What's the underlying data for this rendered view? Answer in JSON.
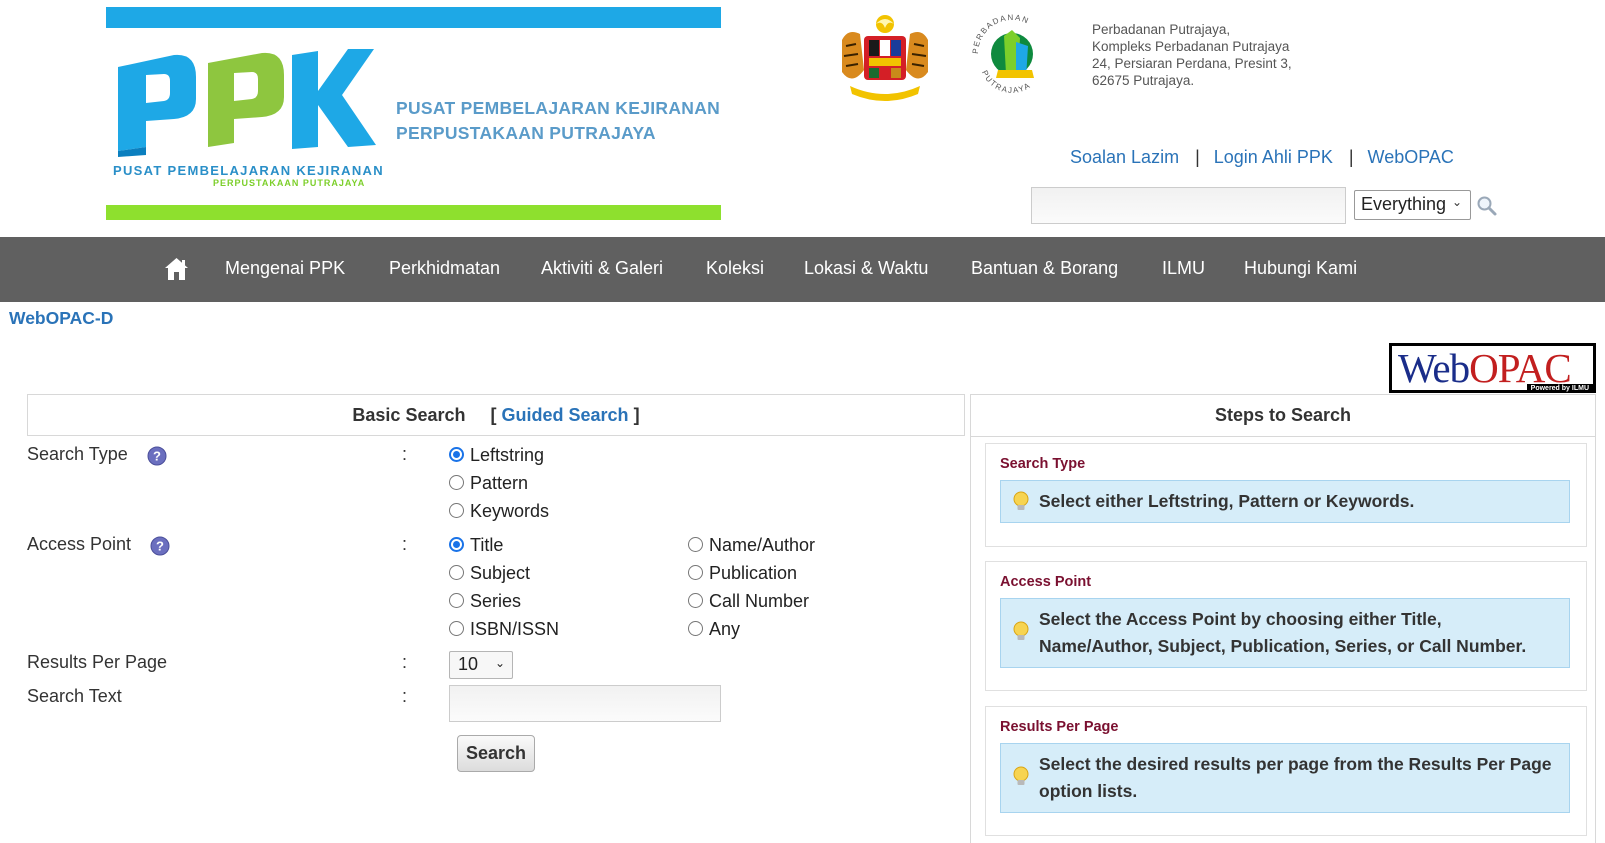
{
  "header": {
    "banner_title_line1": "PUSAT PEMBELAJARAN KEJIRANAN",
    "banner_title_line2": "PERPUSTAKAAN PUTRAJAYA",
    "logo_text": "PPK",
    "logo_sub1": "PUSAT PEMBELAJARAN KEJIRANAN",
    "logo_sub2": "PERPUSTAKAAN PUTRAJAYA",
    "address": [
      "Perbadanan Putrajaya,",
      "Kompleks Perbadanan Putrajaya",
      "24, Persiaran Perdana, Presint 3,",
      "62675 Putrajaya."
    ],
    "links": [
      "Soalan Lazim",
      "Login Ahli PPK",
      "WebOPAC"
    ],
    "separator": "|",
    "search": {
      "value": "",
      "scope": "Everything"
    }
  },
  "nav": {
    "items": [
      "Mengenai PPK",
      "Perkhidmatan",
      "Aktiviti & Galeri",
      "Koleksi",
      "Lokasi & Waktu",
      "Bantuan & Borang",
      "ILMU",
      "Hubungi Kami"
    ]
  },
  "page": {
    "title": "WebOPAC-D",
    "logo_text_a": "Web",
    "logo_text_b": "OPAC",
    "logo_powered": "Powered by ILMU"
  },
  "form": {
    "header_basic": "Basic Search",
    "bracket_open": "[",
    "guided_link": "Guided Search",
    "bracket_close": "]",
    "colon": ":",
    "search_type_label": "Search Type",
    "search_type_options": [
      "Leftstring",
      "Pattern",
      "Keywords"
    ],
    "search_type_selected": "Leftstring",
    "access_point_label": "Access Point",
    "access_point_options": [
      "Title",
      "Subject",
      "Series",
      "ISBN/ISSN",
      "Name/Author",
      "Publication",
      "Call Number",
      "Any"
    ],
    "access_point_selected": "Title",
    "results_per_page_label": "Results Per Page",
    "results_per_page_value": "10",
    "search_text_label": "Search Text",
    "search_text_value": "",
    "search_button": "Search"
  },
  "steps": {
    "title": "Steps to Search",
    "items": [
      {
        "title": "Search Type",
        "text": "Select either Leftstring, Pattern or Keywords."
      },
      {
        "title": "Access Point",
        "text": "Select the Access Point by choosing either Title, Name/Author, Subject, Publication, Series, or Call Number."
      },
      {
        "title": "Results Per Page",
        "text": "Select the desired results per page from the Results Per Page option lists."
      }
    ]
  },
  "colors": {
    "link_blue": "#2a73b8",
    "nav_bg": "#606060",
    "banner_top": "#1ea8e6",
    "banner_bottom": "#8ee02e",
    "step_title": "#7a1030",
    "step_box_bg": "#d6edf9"
  },
  "icons": [
    "home-icon",
    "help-icon",
    "search-icon",
    "lightbulb-icon",
    "crest-icon",
    "perbadanan-logo-icon"
  ]
}
